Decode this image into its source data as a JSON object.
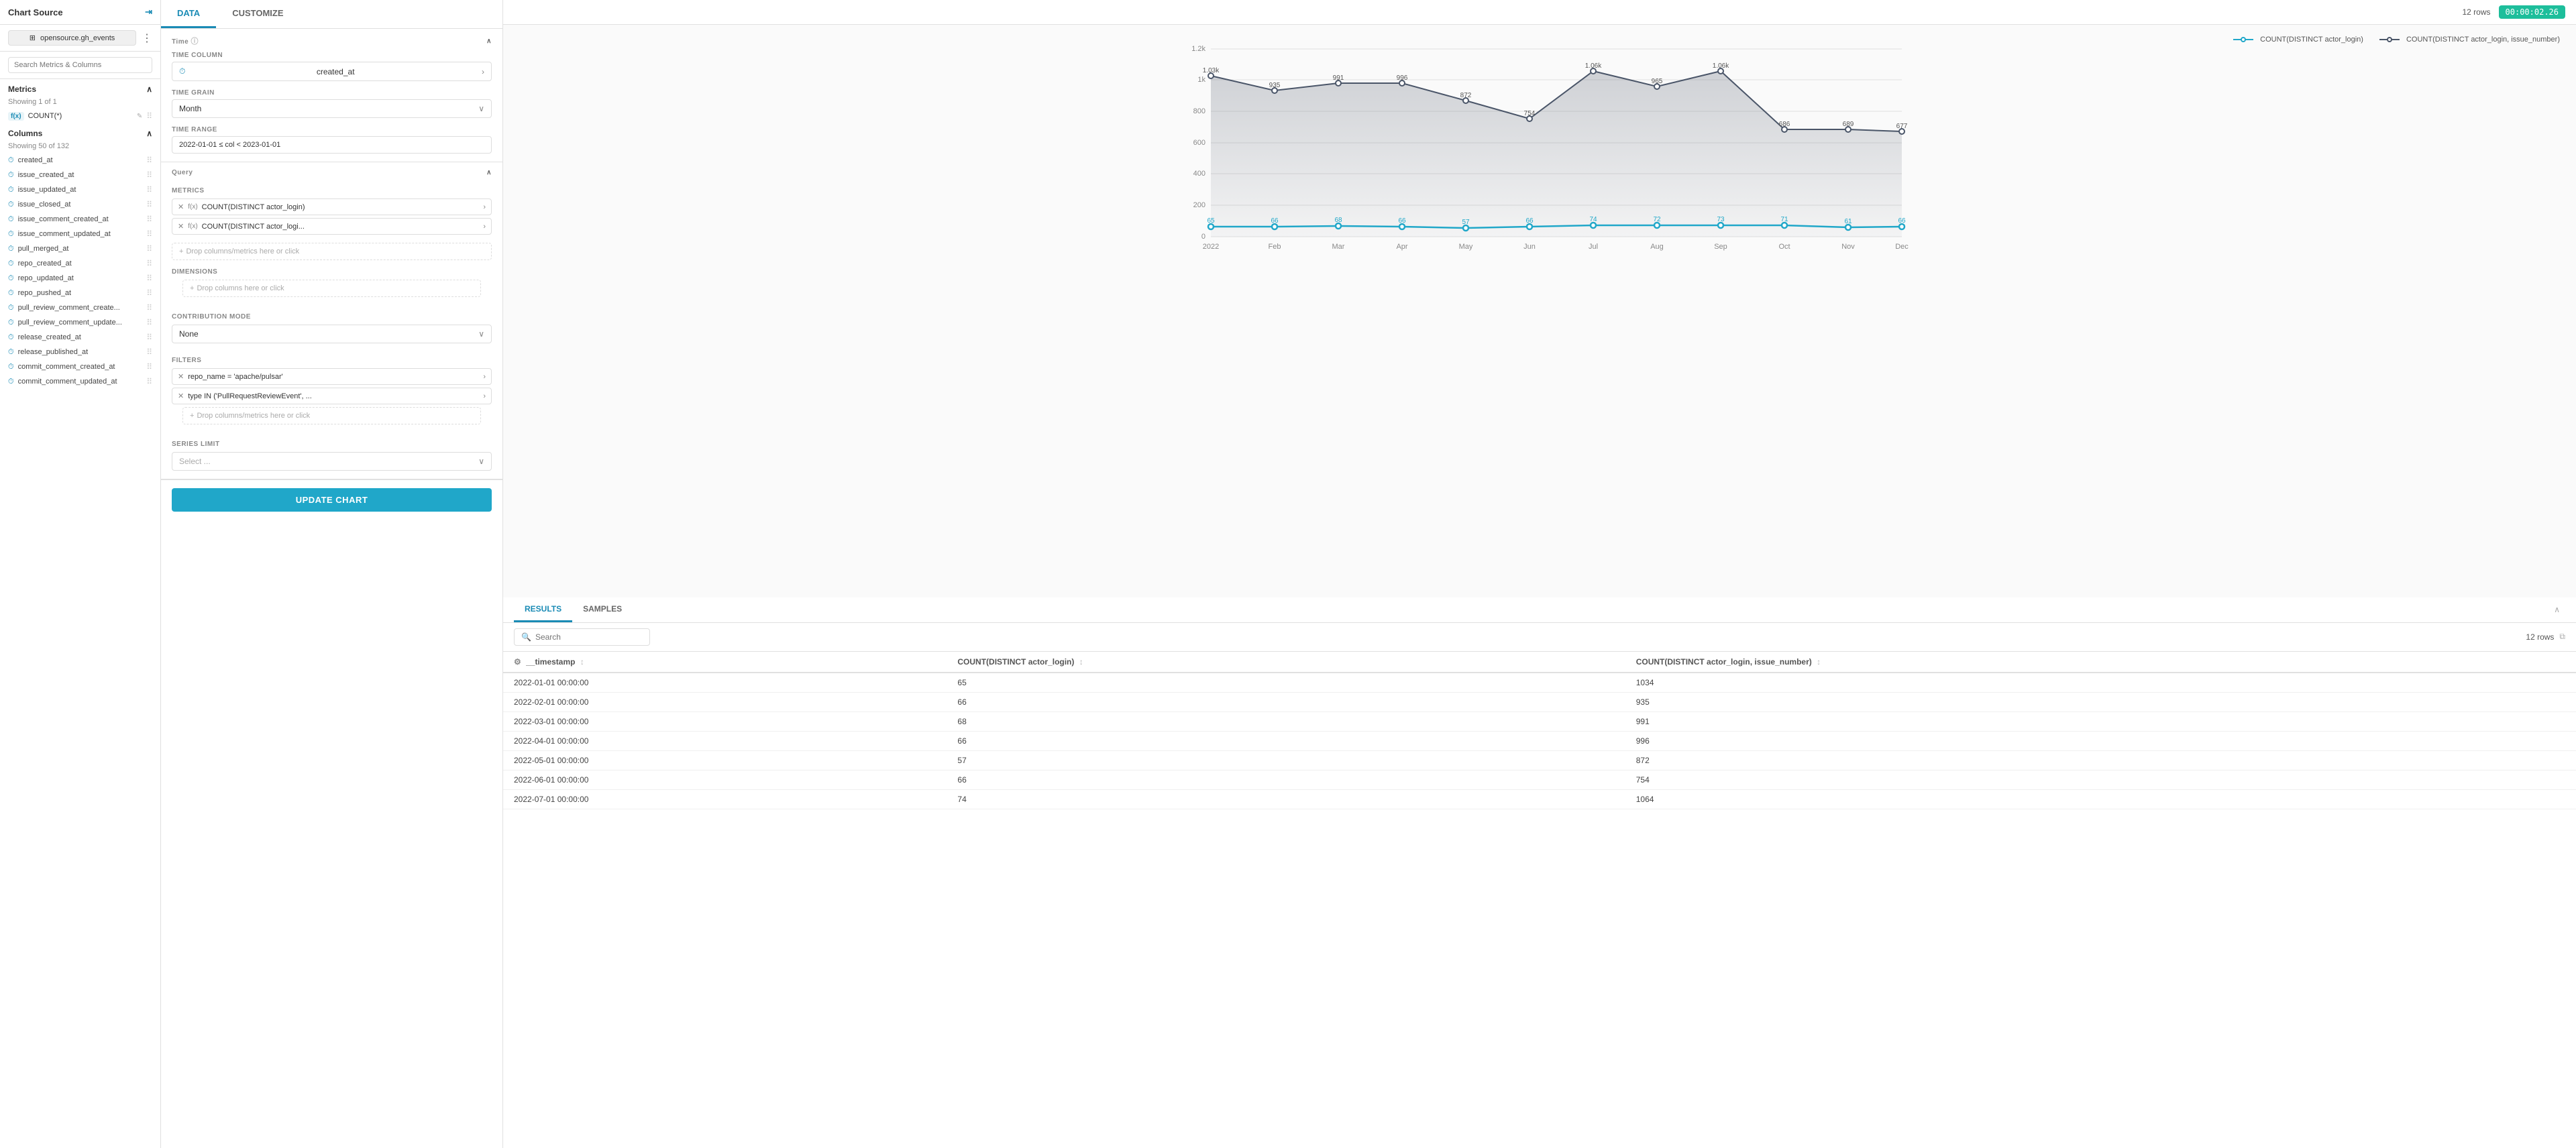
{
  "leftPanel": {
    "chartSourceLabel": "Chart Source",
    "datasourceName": "opensource.gh_events",
    "searchPlaceholder": "Search Metrics & Columns",
    "metricsLabel": "Metrics",
    "metricsShowing": "Showing 1 of 1",
    "metrics": [
      {
        "func": "f(x)",
        "name": "COUNT(*)"
      }
    ],
    "columnsLabel": "Columns",
    "columnsShowing": "Showing 50 of 132",
    "columns": [
      "created_at",
      "issue_created_at",
      "issue_updated_at",
      "issue_closed_at",
      "issue_comment_created_at",
      "issue_comment_updated_at",
      "pull_merged_at",
      "repo_created_at",
      "repo_updated_at",
      "repo_pushed_at",
      "pull_review_comment_create...",
      "pull_review_comment_update...",
      "release_created_at",
      "release_published_at",
      "commit_comment_created_at",
      "commit_comment_updated_at"
    ]
  },
  "midPanel": {
    "tabs": [
      "DATA",
      "CUSTOMIZE"
    ],
    "activeTab": "DATA",
    "timeSection": {
      "label": "Time",
      "timeColumnLabel": "TIME COLUMN",
      "timeColumnValue": "created_at",
      "timeGrainLabel": "TIME GRAIN",
      "timeGrainValue": "Month",
      "timeRangeLabel": "TIME RANGE",
      "timeRangeValue": "2022-01-01 ≤ col < 2023-01-01"
    },
    "querySection": {
      "label": "Query",
      "metricsLabel": "METRICS",
      "metrics": [
        "COUNT(DISTINCT actor_login)",
        "COUNT(DISTINCT actor_logi..."
      ],
      "dropMetricsPlaceholder": "Drop columns/metrics here or click",
      "dimensionsLabel": "DIMENSIONS",
      "dropDimsPlaceholder": "Drop columns here or click",
      "contribModeLabel": "CONTRIBUTION MODE",
      "contribModeValue": "None",
      "filtersLabel": "FILTERS",
      "filters": [
        "repo_name = 'apache/pulsar'",
        "type IN ('PullRequestReviewEvent', ..."
      ],
      "dropFiltersPlaceholder": "Drop columns/metrics here or click",
      "seriesLimitLabel": "SERIES LIMIT",
      "seriesLimitPlaceholder": "Select ..."
    },
    "updateButtonLabel": "UPDATE CHART"
  },
  "rightPanel": {
    "rowsLabel": "12 rows",
    "timerValue": "00:00:02.26",
    "legend": [
      {
        "label": "COUNT(DISTINCT actor_login)",
        "color": "#20a7c9",
        "fill": "transparent"
      },
      {
        "label": "COUNT(DISTINCT actor_login, issue_number)",
        "color": "#4a5568",
        "fill": "transparent"
      }
    ],
    "chart": {
      "xLabels": [
        "2022",
        "Feb",
        "Mar",
        "Apr",
        "May",
        "Jun",
        "Jul",
        "Aug",
        "Sep",
        "Oct",
        "Nov",
        "Dec"
      ],
      "series1": [
        65,
        66,
        68,
        66,
        57,
        66,
        74,
        72,
        73,
        71,
        61,
        66
      ],
      "series2": [
        1034,
        935,
        991,
        996,
        872,
        754,
        1063,
        965,
        1063,
        686,
        689,
        677
      ],
      "yMax": 1200,
      "yLabels": [
        "0",
        "200",
        "400",
        "600",
        "800",
        "1k",
        "1.2k"
      ]
    },
    "resultTabs": [
      "RESULTS",
      "SAMPLES"
    ],
    "activeResultTab": "RESULTS",
    "searchPlaceholder": "Search",
    "tableRowsLabel": "12 rows",
    "tableHeaders": [
      "__timestamp",
      "COUNT(DISTINCT actor_login)",
      "COUNT(DISTINCT actor_login, issue_number)"
    ],
    "tableRows": [
      [
        "2022-01-01 00:00:00",
        "65",
        "1034"
      ],
      [
        "2022-02-01 00:00:00",
        "66",
        "935"
      ],
      [
        "2022-03-01 00:00:00",
        "68",
        "991"
      ],
      [
        "2022-04-01 00:00:00",
        "66",
        "996"
      ],
      [
        "2022-05-01 00:00:00",
        "57",
        "872"
      ],
      [
        "2022-06-01 00:00:00",
        "66",
        "754"
      ],
      [
        "2022-07-01 00:00:00",
        "74",
        "1064"
      ]
    ]
  }
}
